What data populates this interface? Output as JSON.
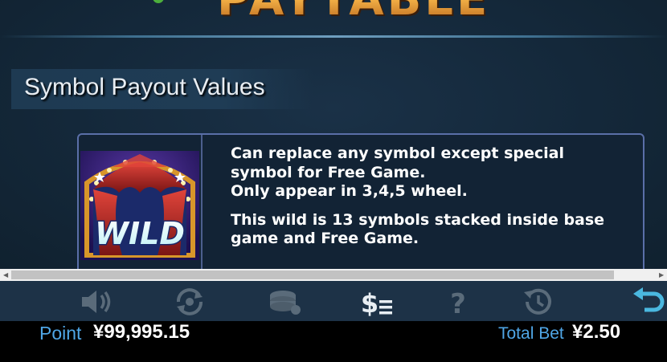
{
  "header": {
    "title": "PAYTABLE"
  },
  "section": {
    "title": "Symbol Payout Values"
  },
  "wild_card": {
    "symbol_text": "WILD",
    "line1": "Can replace any symbol except special",
    "line2": "symbol for Free Game.",
    "line3": "Only appear in 3,4,5 wheel.",
    "line4": "This wild is 13 symbols stacked inside base",
    "line5": "game and Free Game."
  },
  "toolbar": {
    "icons": [
      "sound-icon",
      "autoplay-icon",
      "chips-icon",
      "paytable-icon",
      "help-icon",
      "history-icon",
      "back-icon"
    ],
    "accent": "#4ab8e0"
  },
  "status": {
    "point_label": "Point",
    "point_value": "¥99,995.15",
    "bet_label": "Total Bet",
    "bet_value": "¥2.50"
  },
  "colors": {
    "label_blue": "#4fa6e6",
    "title_gold": "#f0a63a",
    "card_border": "#5a6fa8"
  }
}
